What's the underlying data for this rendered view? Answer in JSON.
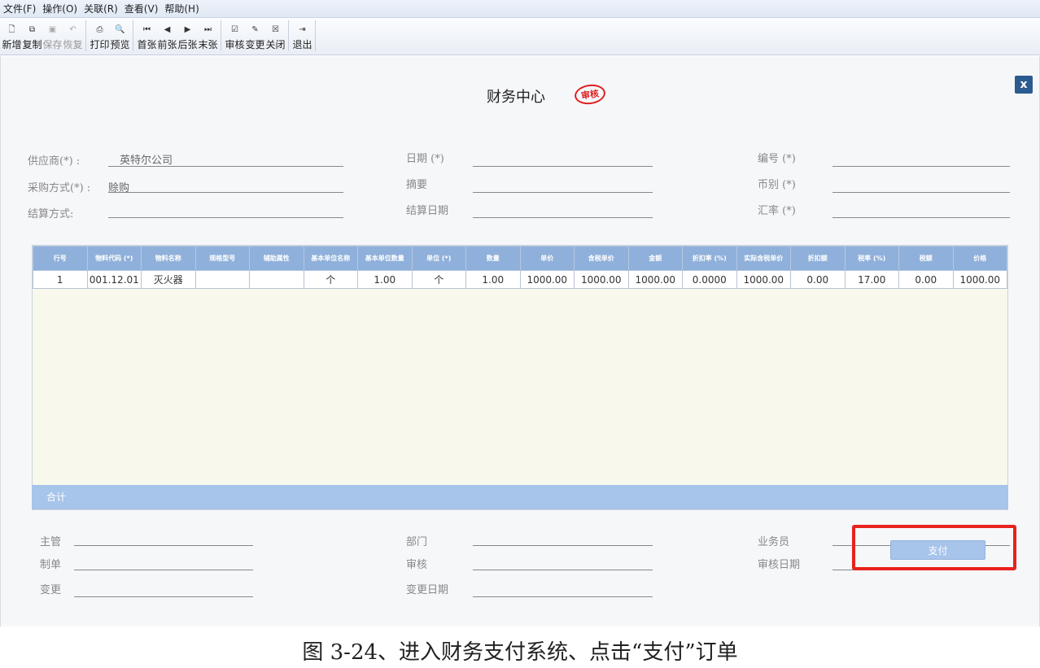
{
  "menu": [
    "文件(F)",
    "操作(O)",
    "关联(R)",
    "查看(V)",
    "帮助(H)"
  ],
  "toolbar": {
    "groups": [
      [
        {
          "icon": "new-icon",
          "glyph": "🗋",
          "label": "新增",
          "enabled": true
        },
        {
          "icon": "copy-icon",
          "glyph": "⧉",
          "label": "复制",
          "enabled": true
        },
        {
          "icon": "save-icon",
          "glyph": "▣",
          "label": "保存",
          "enabled": false
        },
        {
          "icon": "undo-icon",
          "glyph": "↶",
          "label": "恢复",
          "enabled": false
        }
      ],
      [
        {
          "icon": "print-icon",
          "glyph": "⎙",
          "label": "打印",
          "enabled": true
        },
        {
          "icon": "preview-icon",
          "glyph": "🔍",
          "label": "预览",
          "enabled": true
        }
      ],
      [
        {
          "icon": "first-icon",
          "glyph": "⏮",
          "label": "首张",
          "enabled": true
        },
        {
          "icon": "prev-icon",
          "glyph": "◀",
          "label": "前张",
          "enabled": true
        },
        {
          "icon": "next-icon",
          "glyph": "▶",
          "label": "后张",
          "enabled": true
        },
        {
          "icon": "last-icon",
          "glyph": "⏭",
          "label": "末张",
          "enabled": true
        }
      ],
      [
        {
          "icon": "audit-icon",
          "glyph": "☑",
          "label": "审核",
          "enabled": true
        },
        {
          "icon": "change-icon",
          "glyph": "✎",
          "label": "变更",
          "enabled": true
        },
        {
          "icon": "close-doc-icon",
          "glyph": "☒",
          "label": "关闭",
          "enabled": true
        }
      ],
      [
        {
          "icon": "exit-icon",
          "glyph": "⇥",
          "label": "退出",
          "enabled": true
        }
      ]
    ]
  },
  "page": {
    "title": "财务中心",
    "stamp": "审核",
    "close": "x"
  },
  "header_fields": {
    "supplier": {
      "label": "供应商(*) :",
      "value": "英特尔公司"
    },
    "purchase_mode": {
      "label": "采购方式(*) :",
      "value": "赊购"
    },
    "settle_mode": {
      "label": "结算方式:",
      "value": ""
    },
    "date": {
      "label": "日期 (*)",
      "value": ""
    },
    "summary": {
      "label": "摘要",
      "value": ""
    },
    "settle_date": {
      "label": "结算日期",
      "value": ""
    },
    "number": {
      "label": "编号 (*)",
      "value": ""
    },
    "currency": {
      "label": "币别 (*)",
      "value": ""
    },
    "rate": {
      "label": "汇率 (*)",
      "value": ""
    }
  },
  "table": {
    "columns": [
      "行号",
      "物料代码 (*)",
      "物料名称",
      "规格型号",
      "辅助属性",
      "基本单位名称",
      "基本单位数量",
      "单位 (*)",
      "数量",
      "单价",
      "含税单价",
      "金额",
      "折扣率 (%)",
      "实际含税单价",
      "折扣额",
      "税率 (%)",
      "税额",
      "价格"
    ],
    "rows": [
      [
        "1",
        "001.12.01",
        "灭火器",
        "",
        "",
        "个",
        "1.00",
        "个",
        "1.00",
        "1000.00",
        "1000.00",
        "1000.00",
        "0.0000",
        "1000.00",
        "0.00",
        "17.00",
        "0.00",
        "1000.00"
      ]
    ],
    "sum_label": "合计"
  },
  "footer_fields": {
    "manager": "主管",
    "maker": "制单",
    "changer": "变更",
    "dept": "部门",
    "auditor": "审核",
    "change_date": "变更日期",
    "salesman": "业务员",
    "audit_date": "审核日期"
  },
  "pay_button": "支付",
  "caption": "图 3-24、进入财务支付系统、点击“支付”订单"
}
